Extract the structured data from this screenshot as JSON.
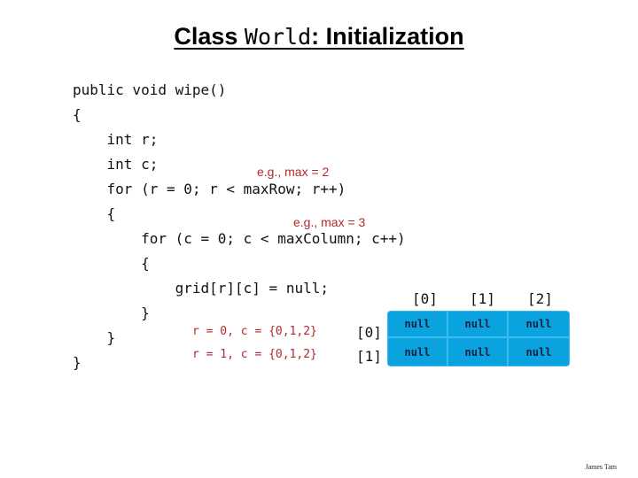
{
  "title": {
    "prefix": "Class ",
    "class_name": "World",
    "suffix": ": Initialization"
  },
  "code_lines": [
    "public void wipe()",
    "{",
    "    int r;",
    "    int c;",
    "    for (r = 0; r < maxRow; r++)",
    "    {",
    "        for (c = 0; c < maxColumn; c++)",
    "        {",
    "            grid[r][c] = null;",
    "        }",
    "    }",
    "}"
  ],
  "annotations": {
    "max_row_note": "e.g., max = 2",
    "max_column_note": "e.g., max = 3",
    "iterations": [
      "r = 0, c = {0,1,2}",
      "r = 1, c = {0,1,2}"
    ]
  },
  "grid": {
    "column_headers": [
      "[0]",
      "[1]",
      "[2]"
    ],
    "row_headers": [
      "[0]",
      "[1]"
    ],
    "cells": [
      [
        "null",
        "null",
        "null"
      ],
      [
        "null",
        "null",
        "null"
      ]
    ],
    "fill_color": "#0aa3e0"
  },
  "footer": "James Tam"
}
